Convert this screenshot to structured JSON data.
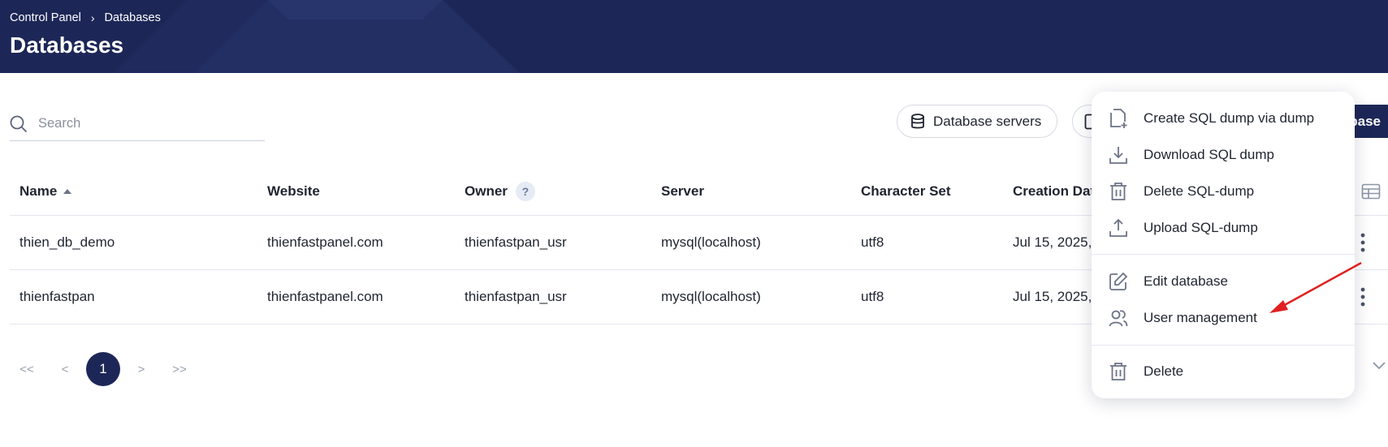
{
  "header": {
    "breadcrumb": [
      "Control Panel",
      "Databases"
    ],
    "title": "Databases"
  },
  "search": {
    "placeholder": "Search"
  },
  "toolbar": {
    "servers_label": "Database servers",
    "create_label_visible": "base"
  },
  "table": {
    "columns": [
      "Name",
      "Website",
      "Owner",
      "Server",
      "Character Set",
      "Creation Dat"
    ],
    "help_glyph": "?",
    "rows": [
      [
        "thien_db_demo",
        "thienfastpanel.com",
        "thienfastpan_usr",
        "mysql(localhost)",
        "utf8",
        "Jul 15, 2025,"
      ],
      [
        "thienfastpan",
        "thienfastpanel.com",
        "thienfastpan_usr",
        "mysql(localhost)",
        "utf8",
        "Jul 15, 2025,"
      ]
    ]
  },
  "pagination": {
    "first": "<<",
    "prev": "<",
    "current": "1",
    "next": ">",
    "last": ">>"
  },
  "menu": {
    "items": [
      {
        "label": "Create SQL dump via dump",
        "icon": "file-plus-icon"
      },
      {
        "label": "Download SQL dump",
        "icon": "download-icon"
      },
      {
        "label": "Delete SQL-dump",
        "icon": "trash-icon"
      },
      {
        "label": "Upload SQL-dump",
        "icon": "upload-icon"
      },
      {
        "label": "Edit database",
        "icon": "edit-icon"
      },
      {
        "label": "User management",
        "icon": "users-icon"
      },
      {
        "label": "Delete",
        "icon": "trash-icon"
      }
    ]
  },
  "colors": {
    "header_bg": "#1d2757",
    "accent": "#1d2757",
    "annotation_arrow": "#e02020"
  }
}
